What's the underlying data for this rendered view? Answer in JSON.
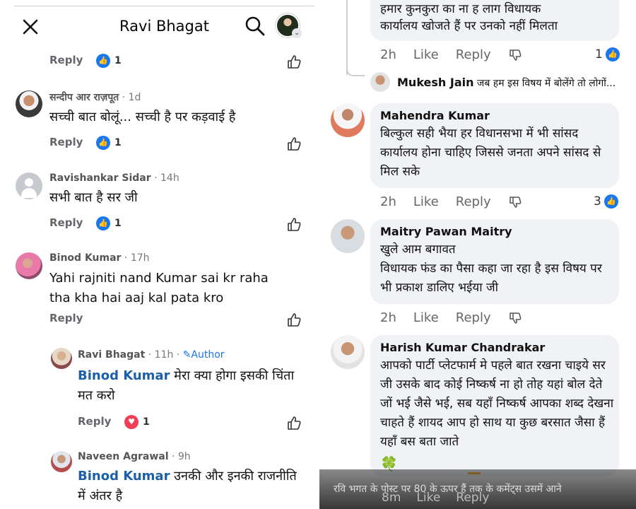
{
  "header": {
    "title": "Ravi Bhagat"
  },
  "left_comments": [
    {
      "name": "",
      "time": "",
      "text": "",
      "reply_label": "Reply",
      "reaction_count": "1"
    },
    {
      "name": "सन्दीप आर राज़पूत",
      "time": "· 1d",
      "text": "सच्ची बात बोलूं... सच्ची है पर कड़वाई है",
      "reply_label": "Reply",
      "reaction_count": "1"
    },
    {
      "name": "Ravishankar Sidar",
      "time": "· 14h",
      "text": "सभी बात है सर जी",
      "reply_label": "Reply",
      "reaction_count": "1"
    },
    {
      "name": "Binod Kumar",
      "time": "· 17h",
      "text": "Yahi rajniti nand Kumar sai kr raha tha kha hai aaj kal pata kro",
      "reply_label": "Reply"
    },
    {
      "name": "Ravi Bhagat",
      "time": "· 11h ·",
      "badge": "Author",
      "mention": "Binod Kumar",
      "text": " मेरा क्या होगा इसकी चिंता मत करो",
      "reply_label": "Reply",
      "reaction_count": "1"
    },
    {
      "name": "Naveen Agrawal",
      "time": "· 9h",
      "mention": "Binod Kumar",
      "text": " उनकी और इनकी राजनीति में अंतर है"
    }
  ],
  "right_top": {
    "partial_text_1": "हमार कुनकुरा का ना ह लाग  विधायक",
    "partial_text_2": "कार्यालय खोजते हैं पर उनको नहीं मिलता",
    "time": "2h",
    "like": "Like",
    "reply": "Reply",
    "reaction_count": "1",
    "reply_preview_name": "Mukesh Jain",
    "reply_preview_text": " जब हम इस विषय में बोलेंगे तो लोगों..."
  },
  "right_comments": [
    {
      "name": "Mahendra Kumar",
      "text": "बिल्कुल सही भैया हर विधानसभा में भी सांसद कार्यालय होना चाहिए जिससे जनता अपने सांसद से मिल सके",
      "time": "2h",
      "like": "Like",
      "reply": "Reply",
      "reaction_count": "3"
    },
    {
      "name": "Maitry Pawan Maitry",
      "text": "खुले आम बगावत\nविधायक फंड का पैसा कहा जा रहा है इस विषय पर भी प्रकाश डालिए भईया जी",
      "time": "2h",
      "like": "Like",
      "reply": "Reply"
    },
    {
      "name": "Harish Kumar Chandrakar",
      "text": "आपको पार्टी प्लेटफार्म मे पहले बात रखना चाइये सर जी उसके बाद कोई निष्कर्ष ना हो तोह यहां बोल देते जों भई जैसे भई, सब यहाँ निष्कर्ष आपका शब्द देखना चाहते हैं शायद आप हो साथ या कुछ बरसात जैसा हैं यहाँ बस बता जाते",
      "emoji": "🍀"
    }
  ],
  "overlay": {
    "text": "रवि भगत के पोस्ट पर 80 के ऊपर हैं तक के कमेंट्स उसमें आने",
    "time": "8m",
    "like": "Like",
    "reply": "Reply"
  }
}
